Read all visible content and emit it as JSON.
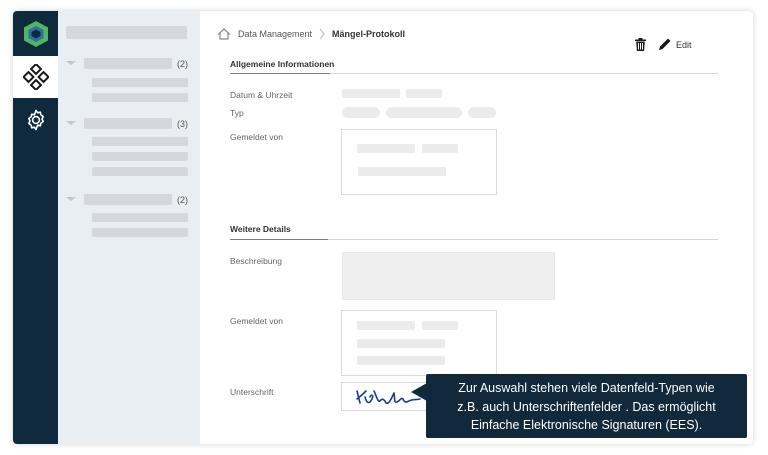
{
  "breadcrumb": {
    "parent": "Data Management",
    "current": "Mängel-Protokoll"
  },
  "actions": {
    "edit_label": "Edit"
  },
  "tree": {
    "groups": [
      {
        "count": "(2)"
      },
      {
        "count": "(3)"
      },
      {
        "count": "(2)"
      }
    ]
  },
  "sections": {
    "general": {
      "title": "Allgemeine Informationen",
      "date_label": "Datum & Uhrzeit",
      "type_label": "Typ",
      "reported_by_label": "Gemeldet von"
    },
    "details": {
      "title": "Weitere Details",
      "description_label": "Beschreibung",
      "reported_by_label": "Gemeldet von",
      "signature_label": "Unterschrift"
    }
  },
  "tooltip": {
    "line1": "Zur Auswahl stehen viele Datenfeld-Typen wie",
    "line2": "z.B. auch Unterschriftenfelder . Das ermöglicht",
    "line3": "Einfache Elektronische Signaturen (EES)."
  },
  "icons": {
    "logo": "hexagon-logo-icon",
    "nodes": "nodes-icon",
    "settings": "gear-icon",
    "home": "home-icon",
    "breadcrumb_separator": "chevron-right-icon",
    "delete": "trash-icon",
    "edit": "pencil-icon"
  },
  "colors": {
    "rail": "#0f2a3d",
    "tooltip": "#11293b",
    "logo_green": "#4fb85e",
    "logo_blue": "#2f6ea8",
    "signature": "#1b3d8f"
  }
}
